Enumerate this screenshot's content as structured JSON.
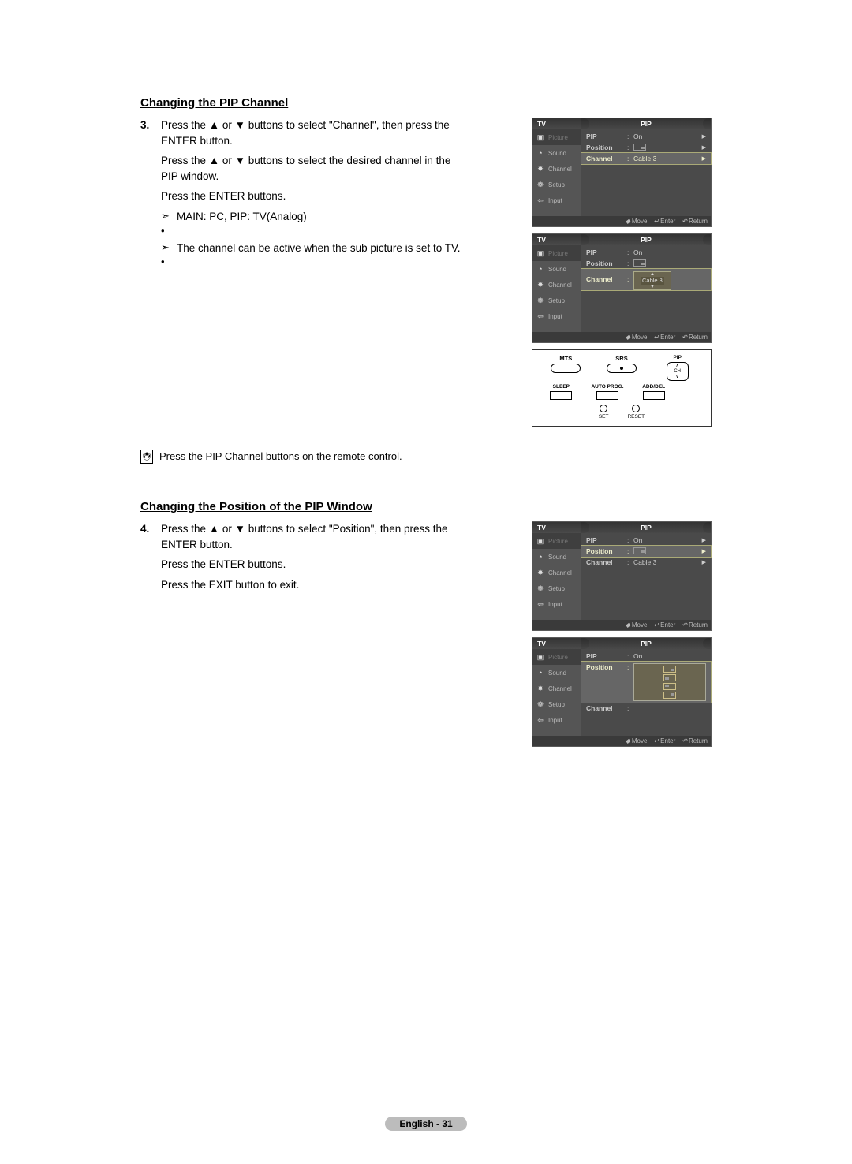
{
  "section1": {
    "title": "Changing the PIP Channel",
    "step_num": "3.",
    "step_line1": "Press the ▲ or ▼ buttons to select \"Channel\", then press the ENTER button.",
    "step_line2": "Press the ▲ or ▼ buttons to select the desired channel in the PIP window.",
    "step_line3": "Press the ENTER buttons.",
    "note1": "MAIN: PC,  PIP: TV(Analog)",
    "note2": "The channel can be active when the sub picture is set to TV.",
    "remote_note": "Press the PIP Channel buttons on the remote control."
  },
  "section2": {
    "title": "Changing the Position of the PIP Window",
    "step_num": "4.",
    "step_line1": "Press the ▲ or ▼ buttons to select \"Position\", then press the ENTER button.",
    "step_line2": "Press the ENTER buttons.",
    "step_line3": "Press the EXIT button to exit."
  },
  "osd": {
    "tv": "TV",
    "pip_title": "PIP",
    "nav": {
      "picture": "Picture",
      "sound": "Sound",
      "channel": "Channel",
      "setup": "Setup",
      "input": "Input"
    },
    "rows": {
      "pip_label": "PIP",
      "pip_value": "On",
      "position_label": "Position",
      "channel_label": "Channel",
      "channel_value": "Cable 3"
    },
    "footer": {
      "move": "Move",
      "enter": "Enter",
      "return": "Return"
    }
  },
  "remote": {
    "mts": "MTS",
    "srs": "SRS",
    "pip": "PIP",
    "sleep": "SLEEP",
    "autoprog": "AUTO PROG.",
    "adddel": "ADD/DEL",
    "ch": "CH",
    "set": "SET",
    "reset": "RESET"
  },
  "footer": {
    "text": "English - 31"
  }
}
